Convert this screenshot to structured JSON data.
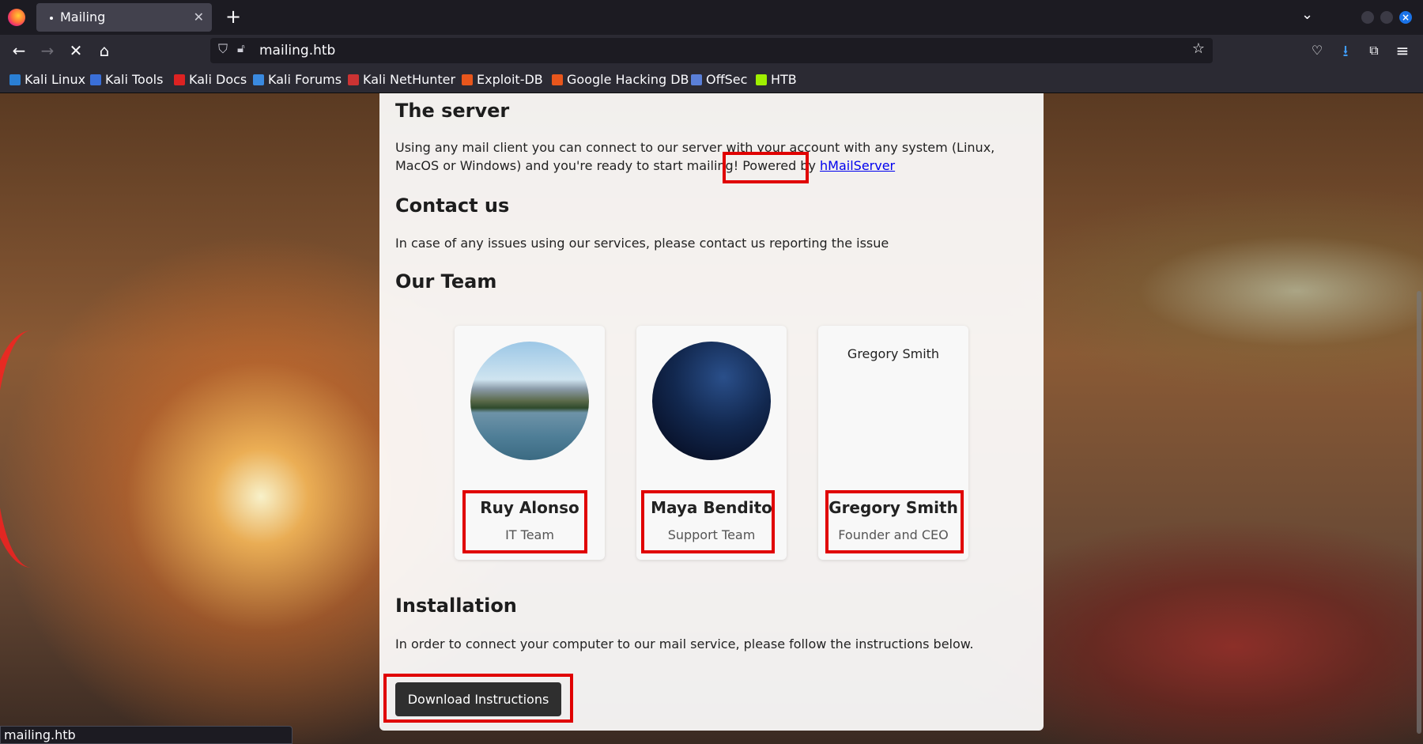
{
  "browser": {
    "tab_title": "Mailing",
    "url": "mailing.htb",
    "bookmarks": [
      "Kali Linux",
      "Kali Tools",
      "Kali Docs",
      "Kali Forums",
      "Kali NetHunter",
      "Exploit-DB",
      "Google Hacking DB",
      "OffSec",
      "HTB"
    ],
    "status_url": "mailing.htb"
  },
  "page": {
    "server": {
      "heading": "The server",
      "text_before_link": "Using any mail client you can connect to our server with your account with any system (Linux, MacOS or Windows) and you're ready to start mailing! Powered by ",
      "link": "hMailServer"
    },
    "contact": {
      "heading": "Contact us",
      "text": "In case of any issues using our services, please contact us reporting the issue"
    },
    "team": {
      "heading": "Our Team",
      "members": [
        {
          "name": "Ruy Alonso",
          "role": "IT Team"
        },
        {
          "name": "Maya Bendito",
          "role": "Support Team"
        },
        {
          "name": "Gregory Smith",
          "role": "Founder and CEO",
          "image_alt": "Gregory Smith"
        }
      ]
    },
    "installation": {
      "heading": "Installation",
      "text": "In order to connect your computer to our mail service, please follow the instructions below.",
      "button": "Download Instructions"
    }
  },
  "colors": {
    "highlight": "#e00000",
    "link": "#0000ee",
    "button_bg": "#2f2f2f"
  }
}
